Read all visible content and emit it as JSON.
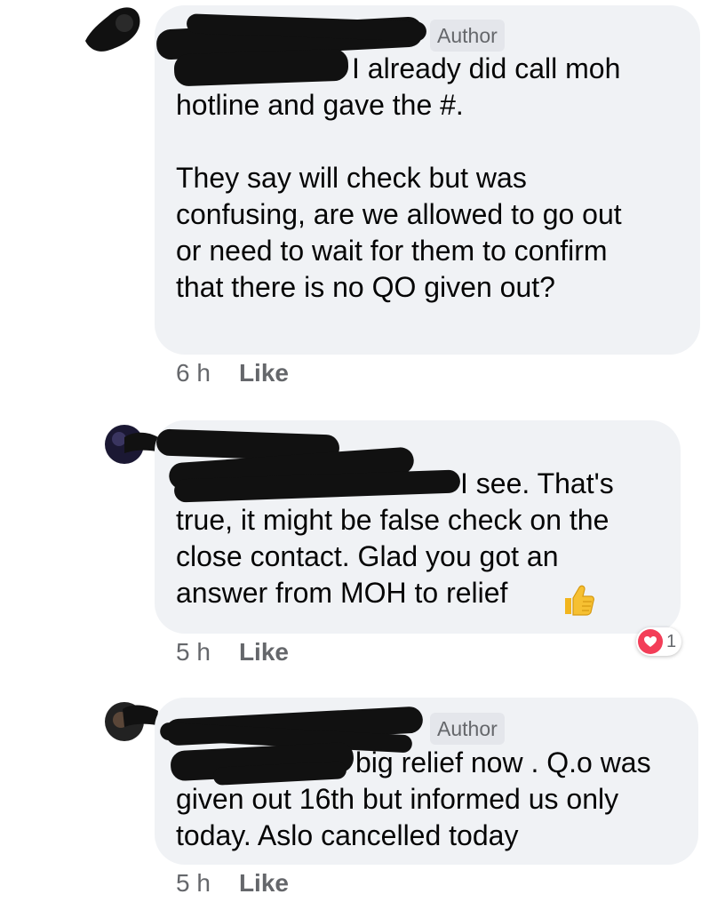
{
  "comments": [
    {
      "author_badge": "Author",
      "text_first_line": "I already did call moh",
      "text_rest": "hotline and gave the #.\n\nThey say will check but was\nconfusing,  are we allowed to go out\nor need to wait for them to confirm\nthat there is no QO given out?",
      "time": "6 h",
      "like_label": "Like"
    },
    {
      "text_first_line": "I see. That's",
      "text_rest": "true, it might be false check on the\nclose contact. Glad you got an\nanswer from MOH to relief",
      "reaction_icon": "heart-reaction-icon",
      "reaction_count": "1",
      "time": "5 h",
      "like_label": "Like"
    },
    {
      "author_badge": "Author",
      "text_first_line": "big relief now . Q.o was",
      "text_rest": "given out 16th but informed us only\ntoday. Aslo cancelled today",
      "time": "5 h",
      "like_label": "Like"
    }
  ],
  "colors": {
    "bubble": "#f0f2f5",
    "meta_text": "#65676b",
    "heart": "#f33e58",
    "redaction": "#111111"
  }
}
